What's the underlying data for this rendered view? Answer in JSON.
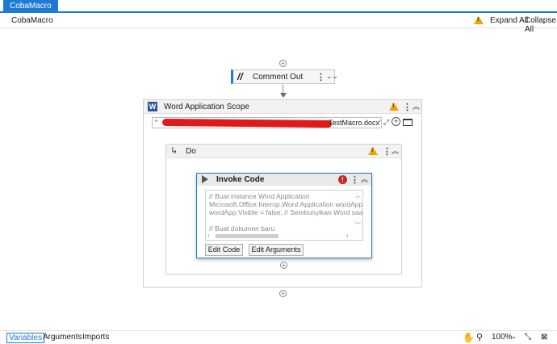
{
  "tabs": [
    {
      "label": "CobaMacro"
    }
  ],
  "breadcrumb": "CobaMacro",
  "toolbar": {
    "expand_all": "Expand All",
    "collapse_all": "Collapse All"
  },
  "comment_out": {
    "label": "Comment Out",
    "icon": "//"
  },
  "word_scope": {
    "title": "Word Application Scope",
    "icon_letter": "W",
    "path_visible": "TestMacro.docx\"",
    "path_prefix": "\""
  },
  "do_block": {
    "title": "Do"
  },
  "invoke_code": {
    "title": "Invoke Code",
    "error_mark": "!",
    "code_lines": [
      "// Buat instance Word Application",
      "Microsoft.Office.Interop.Word.Application wordApp",
      "wordApp.Visible = false; // Sembunyikan Word saat p",
      "",
      "// Buat dokumen baru"
    ],
    "edit_code": "Edit Code",
    "edit_arguments": "Edit Arguments"
  },
  "bottom": {
    "variables": "Variables",
    "arguments": "Arguments",
    "imports": "Imports",
    "zoom": "100%"
  },
  "colors": {
    "accent": "#1f7ad6",
    "warning": "#f2a100",
    "error": "#c62828",
    "redaction": "#e01919"
  }
}
